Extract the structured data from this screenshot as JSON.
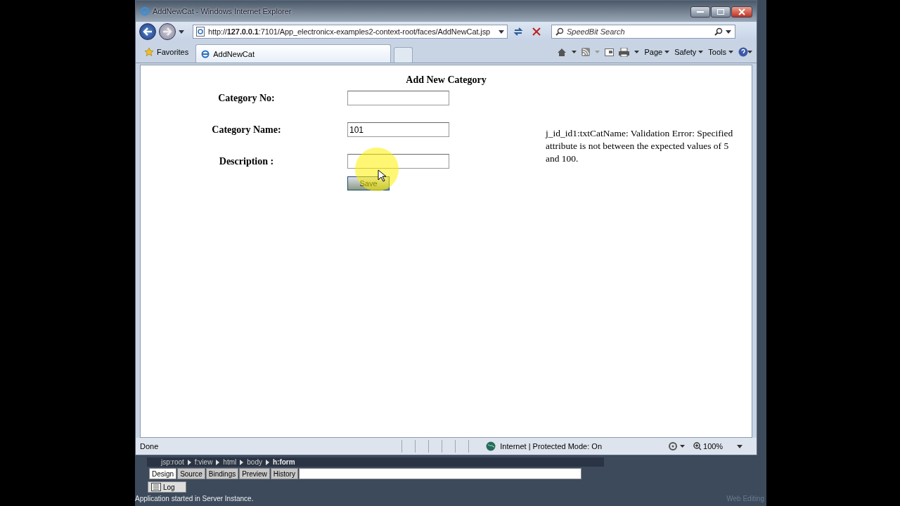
{
  "window": {
    "title": "AddNewCat - Windows Internet Explorer"
  },
  "address_bar": {
    "url": "http://**127.0.0.1**:7101/App_electronicx-examples2-context-root/faces/AddNewCat.jsp"
  },
  "search": {
    "placeholder": "SpeedBit Search"
  },
  "favorites": "Favorites",
  "tabs": [
    {
      "label": "AddNewCat",
      "selected": true
    }
  ],
  "command_bar": [
    "Page",
    "Safety",
    "Tools"
  ],
  "page": {
    "heading": "Add New Category",
    "fields": [
      {
        "label": "Category No:"
      },
      {
        "label": "Category Name:",
        "value": "101"
      },
      {
        "label": "Description :"
      }
    ],
    "button": "Save",
    "error": "j_id_id1:txtCatName: Validation Error: Specified attribute is not between the expected values of 5 and 100."
  },
  "status_bar": {
    "text": "Done",
    "zone": "Internet | Protected Mode: On",
    "zoom": "100%"
  },
  "ide": {
    "breadcrumb": [
      {
        "label": "jsp:root",
        "selected": false
      },
      {
        "label": "f:view",
        "selected": false
      },
      {
        "label": "html",
        "selected": false
      },
      {
        "label": "body",
        "selected": false
      },
      {
        "label": "h:form",
        "selected": true
      }
    ],
    "tabs": [
      {
        "label": "Design",
        "selected": true
      },
      {
        "label": "Source",
        "selected": false
      },
      {
        "label": "Bindings",
        "selected": false
      },
      {
        "label": "Preview",
        "selected": false
      },
      {
        "label": "History",
        "selected": false
      }
    ],
    "log": "Log",
    "message": "Application started in Server Instance.",
    "mode": "Web Editing"
  }
}
